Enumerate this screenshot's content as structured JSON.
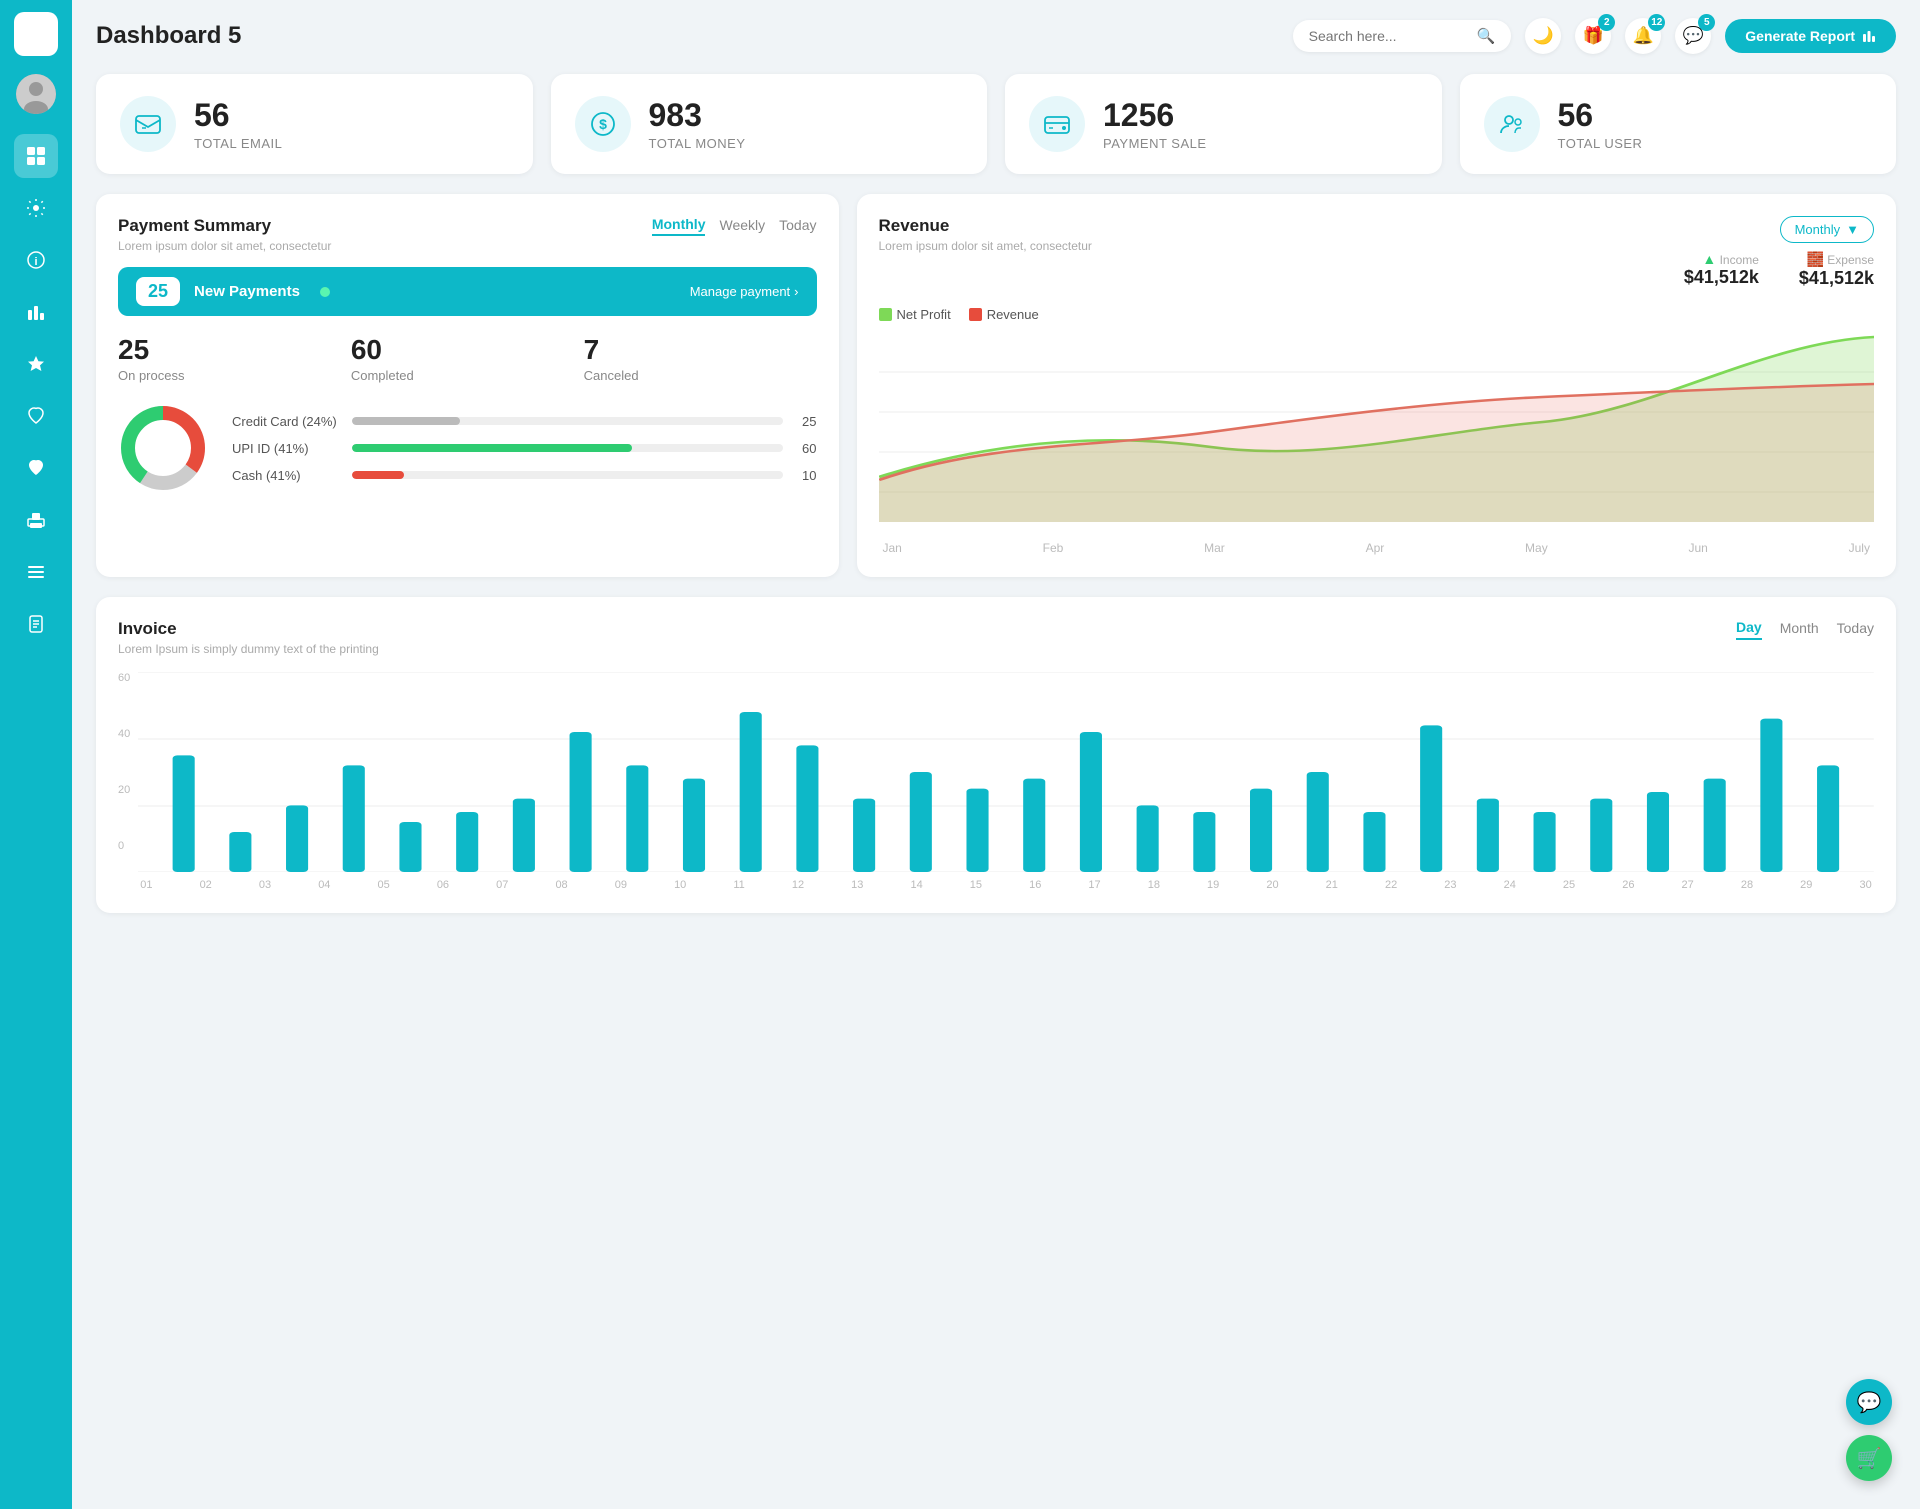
{
  "app": {
    "title": "Dashboard 5"
  },
  "sidebar": {
    "logo": "≡",
    "items": [
      {
        "id": "home",
        "icon": "⊞",
        "active": true
      },
      {
        "id": "settings",
        "icon": "⚙"
      },
      {
        "id": "info",
        "icon": "ℹ"
      },
      {
        "id": "chart",
        "icon": "📊"
      },
      {
        "id": "star",
        "icon": "★"
      },
      {
        "id": "heart-outline",
        "icon": "♡"
      },
      {
        "id": "heart-fill",
        "icon": "♥"
      },
      {
        "id": "print",
        "icon": "🖨"
      },
      {
        "id": "menu",
        "icon": "☰"
      },
      {
        "id": "doc",
        "icon": "📋"
      }
    ]
  },
  "header": {
    "search_placeholder": "Search here...",
    "btn_generate": "Generate Report",
    "icons": [
      {
        "id": "moon",
        "icon": "🌙",
        "badge": null
      },
      {
        "id": "gift",
        "icon": "🎁",
        "badge": "2"
      },
      {
        "id": "bell",
        "icon": "🔔",
        "badge": "12"
      },
      {
        "id": "chat",
        "icon": "💬",
        "badge": "5"
      }
    ]
  },
  "stats": [
    {
      "id": "total-email",
      "num": "56",
      "label": "TOTAL EMAIL",
      "icon": "📋"
    },
    {
      "id": "total-money",
      "num": "983",
      "label": "TOTAL MONEY",
      "icon": "$"
    },
    {
      "id": "payment-sale",
      "num": "1256",
      "label": "PAYMENT SALE",
      "icon": "💳"
    },
    {
      "id": "total-user",
      "num": "56",
      "label": "TOTAL USER",
      "icon": "👥"
    }
  ],
  "payment_summary": {
    "title": "Payment Summary",
    "subtitle": "Lorem ipsum dolor sit amet, consectetur",
    "tabs": [
      "Monthly",
      "Weekly",
      "Today"
    ],
    "active_tab": "Monthly",
    "new_payments_count": "25",
    "new_payments_label": "New Payments",
    "manage_link": "Manage payment",
    "stats": [
      {
        "num": "25",
        "label": "On process"
      },
      {
        "num": "60",
        "label": "Completed"
      },
      {
        "num": "7",
        "label": "Canceled"
      }
    ],
    "bars": [
      {
        "label": "Credit Card (24%)",
        "pct": 25,
        "color": "#bbb",
        "val": "25"
      },
      {
        "label": "UPI ID (41%)",
        "pct": 65,
        "color": "#2ecc71",
        "val": "60"
      },
      {
        "label": "Cash (41%)",
        "pct": 12,
        "color": "#e74c3c",
        "val": "10"
      }
    ],
    "donut": {
      "segments": [
        {
          "pct": 24,
          "color": "#bbb"
        },
        {
          "pct": 41,
          "color": "#2ecc71"
        },
        {
          "pct": 35,
          "color": "#e74c3c"
        }
      ]
    }
  },
  "revenue": {
    "title": "Revenue",
    "subtitle": "Lorem ipsum dolor sit amet, consectetur",
    "dropdown_label": "Monthly",
    "income_label": "Income",
    "income_val": "$41,512k",
    "expense_label": "Expense",
    "expense_val": "$41,512k",
    "legend": [
      {
        "label": "Net Profit",
        "color": "#7ed957"
      },
      {
        "label": "Revenue",
        "color": "#e74c3c"
      }
    ],
    "x_labels": [
      "Jan",
      "Feb",
      "Mar",
      "Apr",
      "May",
      "Jun",
      "July"
    ],
    "y_labels": [
      "0",
      "30",
      "60",
      "90",
      "120"
    ],
    "net_profit_points": [
      8,
      28,
      32,
      22,
      38,
      30,
      95
    ],
    "revenue_points": [
      6,
      32,
      28,
      36,
      42,
      50,
      52
    ]
  },
  "invoice": {
    "title": "Invoice",
    "subtitle": "Lorem Ipsum is simply dummy text of the printing",
    "tabs": [
      "Day",
      "Month",
      "Today"
    ],
    "active_tab": "Day",
    "y_labels": [
      "0",
      "20",
      "40",
      "60"
    ],
    "x_labels": [
      "01",
      "02",
      "03",
      "04",
      "05",
      "06",
      "07",
      "08",
      "09",
      "10",
      "11",
      "12",
      "13",
      "14",
      "15",
      "16",
      "17",
      "18",
      "19",
      "20",
      "21",
      "22",
      "23",
      "24",
      "25",
      "26",
      "27",
      "28",
      "29",
      "30"
    ],
    "bars": [
      35,
      12,
      20,
      32,
      15,
      18,
      22,
      42,
      32,
      28,
      48,
      38,
      22,
      30,
      25,
      28,
      42,
      20,
      18,
      25,
      30,
      18,
      44,
      22,
      18,
      22,
      24,
      28,
      46,
      32
    ]
  },
  "fab": [
    {
      "id": "support",
      "icon": "💬",
      "color": "#0db8c8"
    },
    {
      "id": "cart",
      "icon": "🛒",
      "color": "#2ecc71"
    }
  ]
}
